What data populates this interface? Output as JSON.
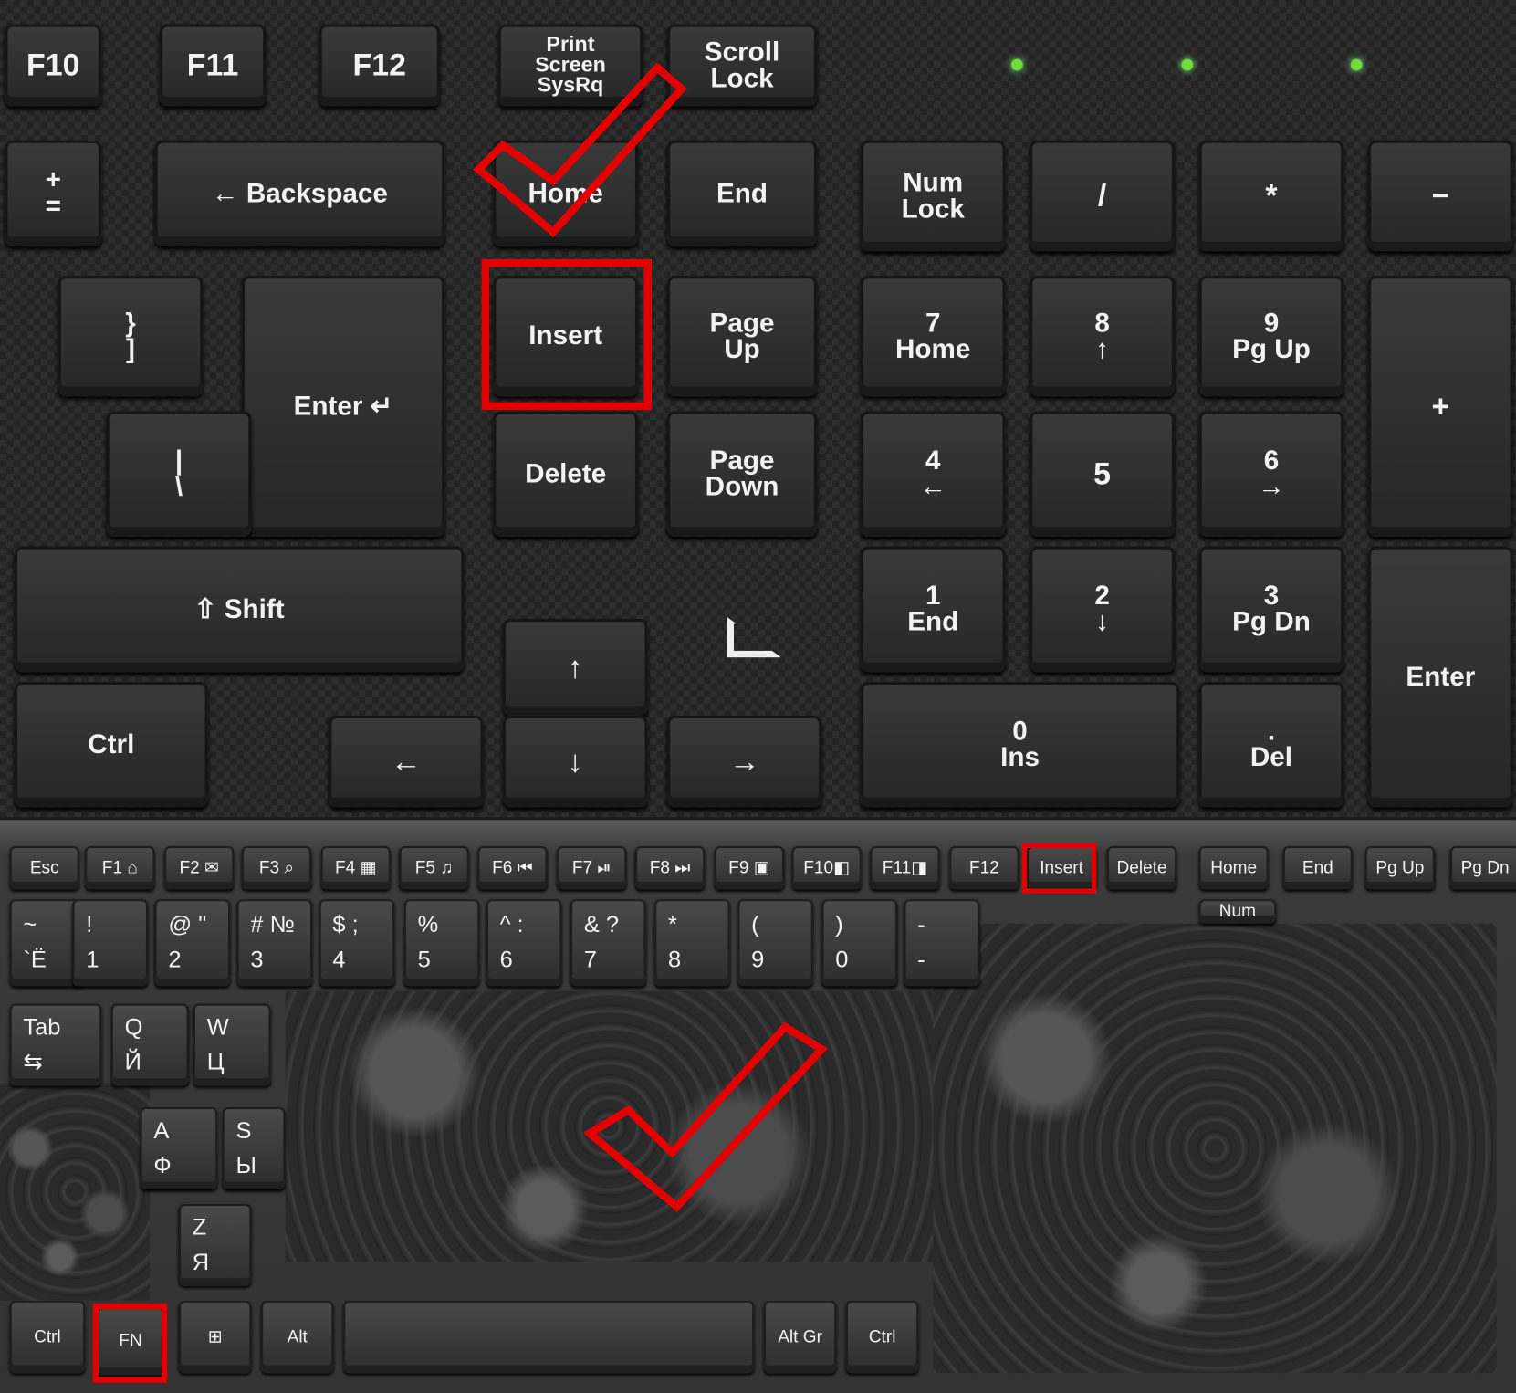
{
  "top_keyboard": {
    "keys": {
      "f10": "F10",
      "f11": "F11",
      "f12": "F12",
      "print": "Print\nScreen\nSysRq",
      "scroll": "Scroll\nLock",
      "plus_eq": "+\n=",
      "backspace": "← Backspace",
      "home": "Home",
      "end": "End",
      "numlock": "Num\nLock",
      "slash": "/",
      "star": "*",
      "minus": "−",
      "brace": "}\n]",
      "enter": "Enter ↵",
      "insert": "Insert",
      "pageup": "Page\nUp",
      "n7": "7\nHome",
      "n8": "8\n↑",
      "n9": "9\nPg Up",
      "nplus": "+",
      "pipe": "|\n\\",
      "delete": "Delete",
      "pagedown": "Page\nDown",
      "n4": "4\n←",
      "n5": "5",
      "n6": "6\n→",
      "shift": "⇧ Shift",
      "n1": "1\nEnd",
      "n2": "2\n↓",
      "n3": "3\nPg Dn",
      "nenter": "Enter",
      "up": "↑",
      "ctrl": "Ctrl",
      "left": "←",
      "down": "↓",
      "right": "→",
      "n0": "0\nIns",
      "ndel": ".\nDel"
    },
    "led_color": "#6fdc3c",
    "next_arrow": "›"
  },
  "bottom_keyboard": {
    "keys": {
      "esc": "Esc",
      "f1": "F1 ⌂",
      "f2": "F2 ✉",
      "f3": "F3 ⌕",
      "f4": "F4 ▦",
      "f5": "F5 ♫",
      "f6": "F6 ⏮",
      "f7": "F7 ⏯",
      "f8": "F8 ⏭",
      "f9": "F9 ▣",
      "f10": "F10◧",
      "f11": "F11◨",
      "f12": "F12",
      "insert": "Insert",
      "delete": "Delete",
      "home": "Home",
      "end": "End",
      "pgup": "Pg Up",
      "pgdn": "Pg Dn",
      "tilde": "~\n`Ё",
      "k1": "!\n1",
      "k2": "@ \"\n2",
      "k3": "# №\n3",
      "k4": "$ ;\n4",
      "k5": "%\n5",
      "k6": "^ :\n6",
      "k7": "& ?\n7",
      "k8": "*\n8",
      "k9": "(\n9",
      "k0": ")\n0",
      "minus": "-\n-",
      "num": "Num",
      "tab": "Tab\n⇆",
      "q": "Q\nЙ",
      "w": "W\nЦ",
      "a": "A\nФ",
      "s": "S\nЫ",
      "z": "Z\nЯ",
      "ctrl": "Ctrl",
      "fn": "FN",
      "win": "⊞",
      "alt": "Alt",
      "space": "",
      "altgr": "Alt Gr",
      "rctrl": "Ctrl"
    }
  },
  "highlight_color": "#e30000"
}
